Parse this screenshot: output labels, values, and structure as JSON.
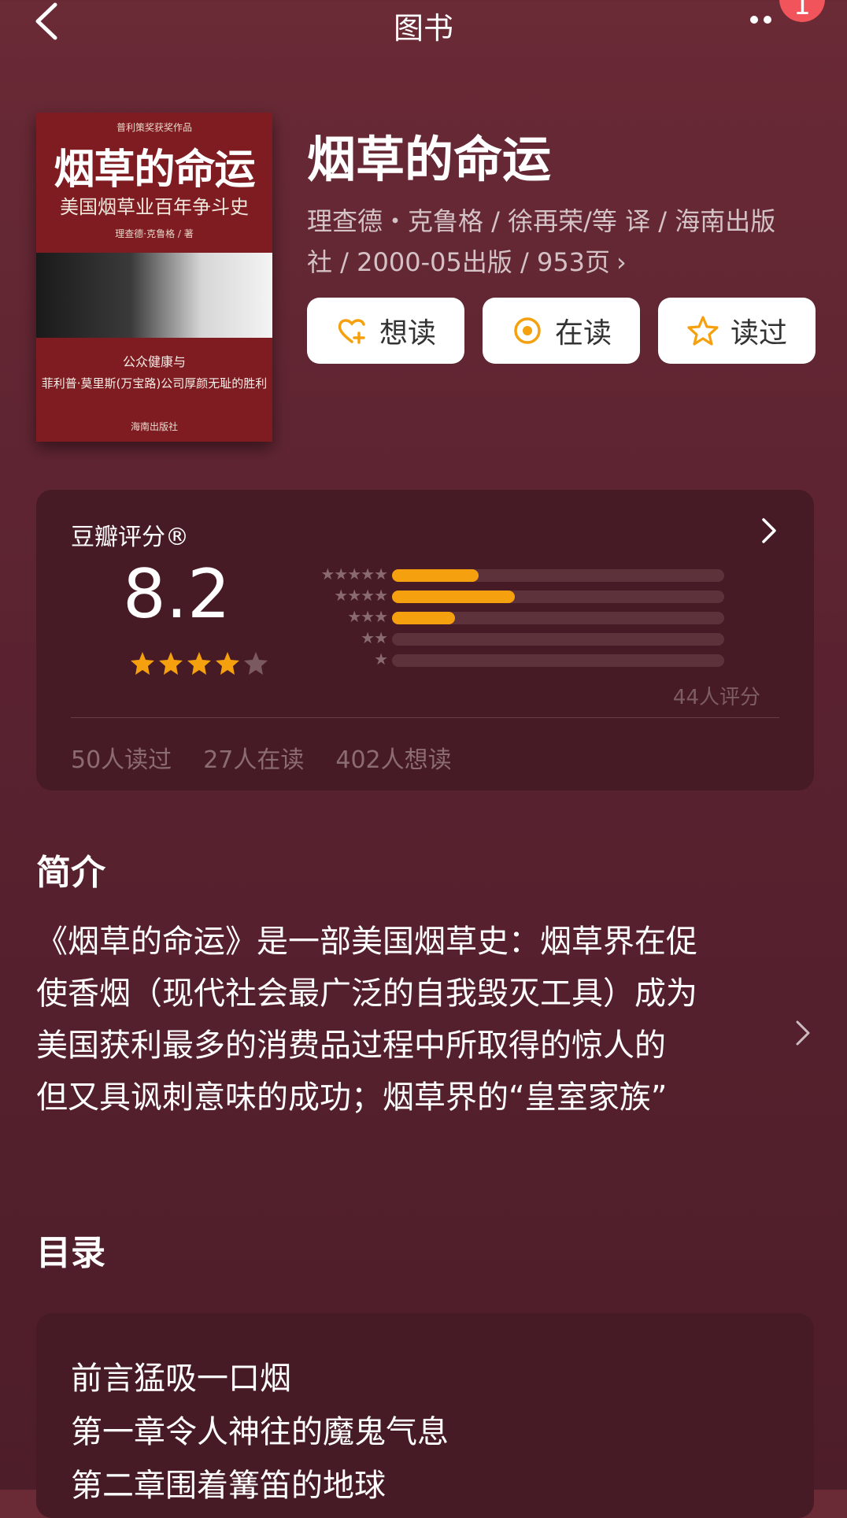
{
  "header": {
    "title": "图书",
    "badge": "1"
  },
  "cover": {
    "top_text": "普利策奖获奖作品",
    "title": "烟草的命运",
    "subtitle": "美国烟草业百年争斗史",
    "author": "理查德·克鲁格 / 著",
    "line1": "公众健康与",
    "line2": "菲利普·莫里斯(万宝路)公司厚颜无耻的胜利",
    "publisher": "海南出版社"
  },
  "book": {
    "title": "烟草的命运",
    "meta_line1": "理查德・克鲁格 / 徐再荣/等 译 / 海南出版",
    "meta_line2": "社 / 2000-05出版 / 953页",
    "meta_chevron": "›"
  },
  "actions": [
    {
      "label": "想读",
      "icon": "heart-plus-icon"
    },
    {
      "label": "在读",
      "icon": "target-icon"
    },
    {
      "label": "读过",
      "icon": "star-outline-icon"
    }
  ],
  "rating": {
    "title": "豆瓣评分®",
    "score": "8.2",
    "stars": 4,
    "distribution": [
      {
        "stars": "★★★★★",
        "fraction": 0.26
      },
      {
        "stars": "★★★★",
        "fraction": 0.37
      },
      {
        "stars": "★★★",
        "fraction": 0.19
      },
      {
        "stars": "★★",
        "fraction": 0.0
      },
      {
        "stars": "★",
        "fraction": 0.0
      }
    ],
    "count": "44人评分",
    "stats": [
      "50人读过",
      "27人在读",
      "402人想读"
    ]
  },
  "intro": {
    "heading": "简介",
    "lines": [
      "《烟草的命运》是一部美国烟草史：烟草界在促",
      "使香烟（现代社会最广泛的自我毁灭工具）成为",
      "美国获利最多的消费品过程中所取得的惊人的",
      "但又具讽刺意味的成功；烟草界的“皇室家族”"
    ]
  },
  "toc": {
    "heading": "目录",
    "items": [
      "前言猛吸一口烟",
      "第一章令人神往的魔鬼气息",
      "第二章围着篝笛的地球"
    ]
  },
  "colors": {
    "accent": "#f5a00f",
    "background": "#5a2230",
    "card": "#471b25"
  }
}
